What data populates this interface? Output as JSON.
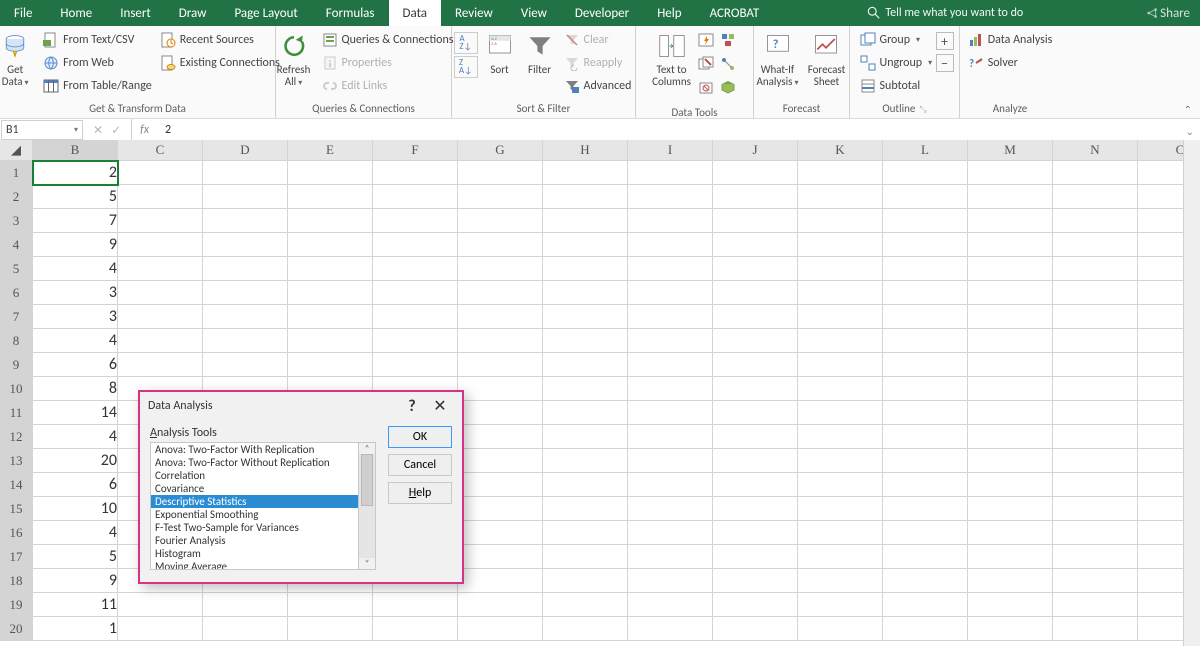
{
  "menubar": {
    "tabs": [
      "File",
      "Home",
      "Insert",
      "Draw",
      "Page Layout",
      "Formulas",
      "Data",
      "Review",
      "View",
      "Developer",
      "Help",
      "ACROBAT"
    ],
    "active": "Data",
    "tell_me": "Tell me what you want to do",
    "share": "Share"
  },
  "ribbon": {
    "group1": {
      "get_data": "Get\nData",
      "items": [
        "From Text/CSV",
        "From Web",
        "From Table/Range",
        "Recent Sources",
        "Existing Connections"
      ],
      "label": "Get & Transform Data"
    },
    "group2": {
      "refresh": "Refresh\nAll",
      "items": [
        "Queries & Connections",
        "Properties",
        "Edit Links"
      ],
      "label": "Queries & Connections"
    },
    "group3": {
      "sort": "Sort",
      "filter": "Filter",
      "clear": "Clear",
      "reapply": "Reapply",
      "advanced": "Advanced",
      "label": "Sort & Filter"
    },
    "group4": {
      "text_to_cols": "Text to\nColumns",
      "label": "Data Tools"
    },
    "group5": {
      "whatif": "What-If\nAnalysis",
      "forecast": "Forecast\nSheet",
      "label": "Forecast"
    },
    "group6": {
      "group": "Group",
      "ungroup": "Ungroup",
      "subtotal": "Subtotal",
      "label": "Outline"
    },
    "group7": {
      "data_analysis": "Data Analysis",
      "solver": "Solver",
      "label": "Analyze"
    }
  },
  "formula_bar": {
    "name_box": "B1",
    "fx": "fx",
    "value": "2"
  },
  "sheet": {
    "columns": [
      "B",
      "C",
      "D",
      "E",
      "F",
      "G",
      "H",
      "I",
      "J",
      "K",
      "L",
      "M",
      "N",
      "C"
    ],
    "rows": 20,
    "col_b": [
      2,
      5,
      7,
      9,
      4,
      3,
      3,
      4,
      6,
      8,
      14,
      4,
      20,
      6,
      10,
      4,
      5,
      9,
      11,
      1
    ]
  },
  "dialog": {
    "title": "Data Analysis",
    "subtitle_u": "A",
    "subtitle_rest": "nalysis Tools",
    "items": [
      "Anova: Two-Factor With Replication",
      "Anova: Two-Factor Without Replication",
      "Correlation",
      "Covariance",
      "Descriptive Statistics",
      "Exponential Smoothing",
      "F-Test Two-Sample for Variances",
      "Fourier Analysis",
      "Histogram",
      "Moving Average"
    ],
    "selected": "Descriptive Statistics",
    "ok": "OK",
    "cancel": "Cancel",
    "help_u": "H",
    "help_rest": "elp"
  }
}
